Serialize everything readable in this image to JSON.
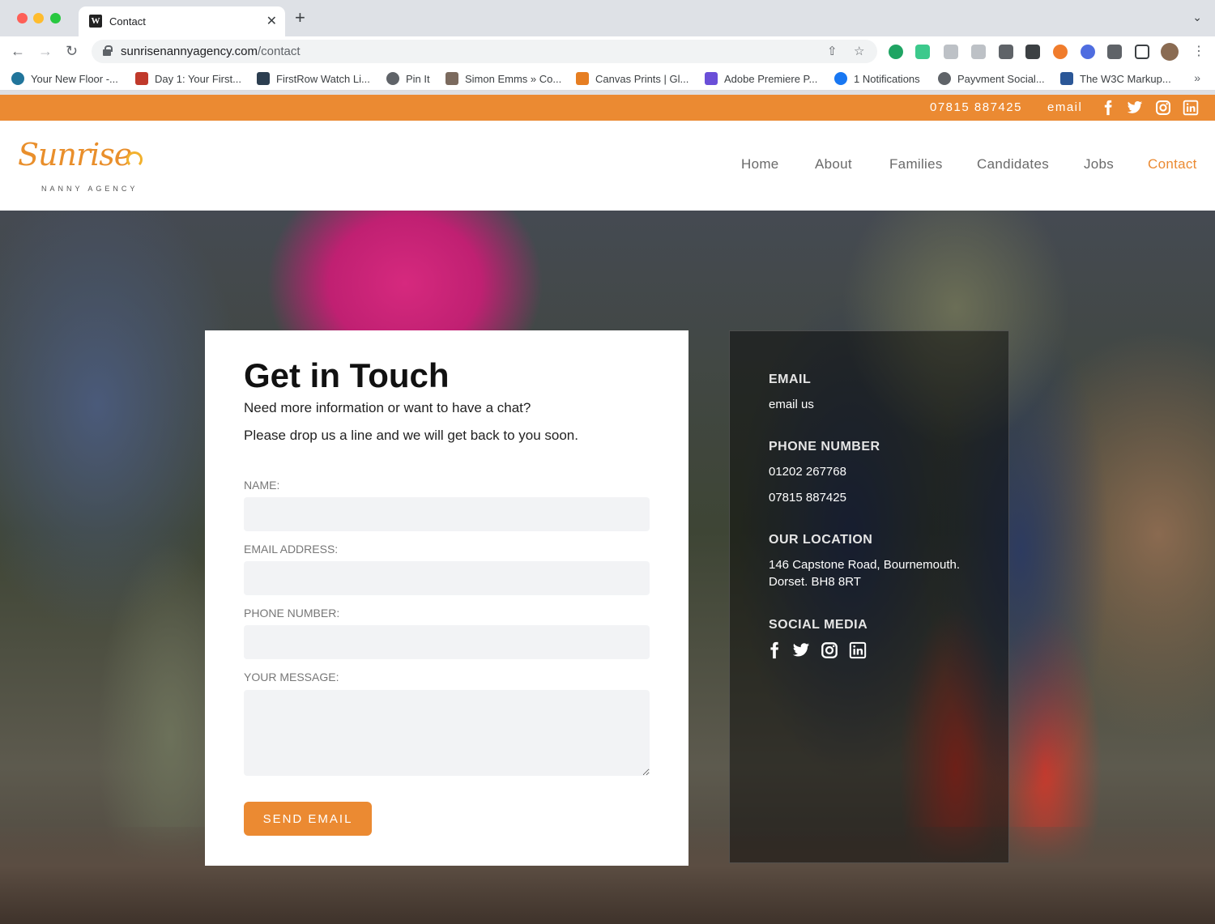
{
  "browser": {
    "tab_title": "Contact",
    "tab_favicon": "W",
    "url_host": "sunrisenannyagency.com",
    "url_path": "/contact",
    "bookmarks": [
      "Your New Floor -...",
      "Day 1: Your First...",
      "FirstRow Watch Li...",
      "Pin It",
      "Simon Emms » Co...",
      "Canvas Prints | Gl...",
      "Adobe Premiere P...",
      "1 Notifications",
      "Payvment Social...",
      "The W3C Markup..."
    ],
    "bookmarks_overflow": "»"
  },
  "topbar": {
    "phone": "07815 887425",
    "email_label": "email"
  },
  "logo": {
    "word": "Sunrise",
    "sub": "NANNY AGENCY"
  },
  "nav": {
    "items": [
      "Home",
      "About",
      "Families",
      "Candidates",
      "Jobs",
      "Contact"
    ],
    "active": "Contact"
  },
  "form": {
    "title": "Get in Touch",
    "intro_line1": "Need more information or want to have a chat?",
    "intro_line2": "Please drop us a line and we will get back to you soon.",
    "name_label": "NAME:",
    "email_label": "EMAIL ADDRESS:",
    "phone_label": "PHONE NUMBER:",
    "message_label": "YOUR MESSAGE:",
    "name_value": "",
    "email_value": "",
    "phone_value": "",
    "message_value": "",
    "submit_label": "SEND EMAIL"
  },
  "info": {
    "email_heading": "EMAIL",
    "email_text": "email us",
    "phone_heading": "PHONE NUMBER",
    "phone1": "01202 267768",
    "phone2": "07815 887425",
    "location_heading": "OUR LOCATION",
    "address_line1": "146 Capstone Road, Bournemouth.",
    "address_line2": "Dorset. BH8 8RT",
    "social_heading": "SOCIAL MEDIA"
  },
  "colors": {
    "accent": "#eb8a32",
    "nav_text": "#6a6a6a"
  }
}
